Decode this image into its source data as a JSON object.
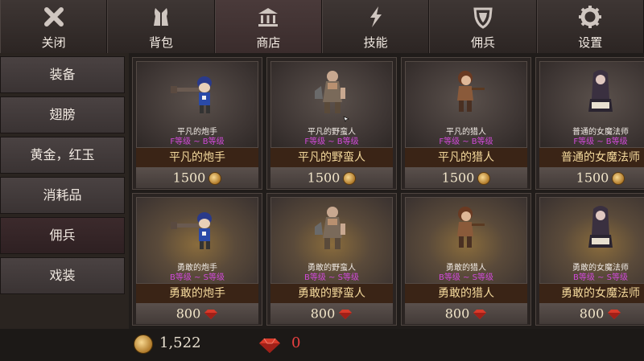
{
  "tabs": [
    {
      "label": "关闭",
      "icon": "close-icon"
    },
    {
      "label": "背包",
      "icon": "backpack-icon"
    },
    {
      "label": "商店",
      "icon": "shop-icon"
    },
    {
      "label": "技能",
      "icon": "lightning-icon"
    },
    {
      "label": "佣兵",
      "icon": "shield-icon"
    },
    {
      "label": "设置",
      "icon": "gear-icon"
    }
  ],
  "active_tab": "商店",
  "sidebar": {
    "items": [
      {
        "label": "装备"
      },
      {
        "label": "翅膀"
      },
      {
        "label": "黄金，红玉"
      },
      {
        "label": "消耗品"
      },
      {
        "label": "佣兵"
      },
      {
        "label": "戏装"
      }
    ],
    "active": "佣兵"
  },
  "cards": [
    {
      "sub1": "平凡的炮手",
      "grade": "F等级 ~ B等级",
      "name": "平凡的炮手",
      "price": "1500",
      "currency": "gold-coin-icon"
    },
    {
      "sub1": "平凡的野蛮人",
      "grade": "F等级 ~ B等级",
      "name": "平凡的野蛮人",
      "price": "1500",
      "currency": "gold-coin-icon"
    },
    {
      "sub1": "平凡的猎人",
      "grade": "F等级 ~ B等级",
      "name": "平凡的猎人",
      "price": "1500",
      "currency": "gold-coin-icon"
    },
    {
      "sub1": "普通的女魔法师",
      "grade": "F等级 ~ B等级",
      "name": "普通的女魔法师",
      "price": "1500",
      "currency": "gold-coin-icon"
    },
    {
      "sub1": "勇敢的炮手",
      "grade": "B等级 ~ S等级",
      "name": "勇敢的炮手",
      "price": "800",
      "currency": "ruby-icon"
    },
    {
      "sub1": "勇敢的野蛮人",
      "grade": "B等级 ~ S等级",
      "name": "勇敢的野蛮人",
      "price": "800",
      "currency": "ruby-icon"
    },
    {
      "sub1": "勇敢的猎人",
      "grade": "B等级 ~ S等级",
      "name": "勇敢的猎人",
      "price": "800",
      "currency": "ruby-icon"
    },
    {
      "sub1": "勇敢的女魔法师",
      "grade": "B等级 ~ S等级",
      "name": "勇敢的女魔法师",
      "price": "800",
      "currency": "ruby-icon"
    }
  ],
  "currency": {
    "gold": "1,522",
    "ruby": "0"
  },
  "colors": {
    "grade_text": "#d04ad8",
    "name_text": "#f4d99c",
    "ruby_text": "#e84040"
  }
}
